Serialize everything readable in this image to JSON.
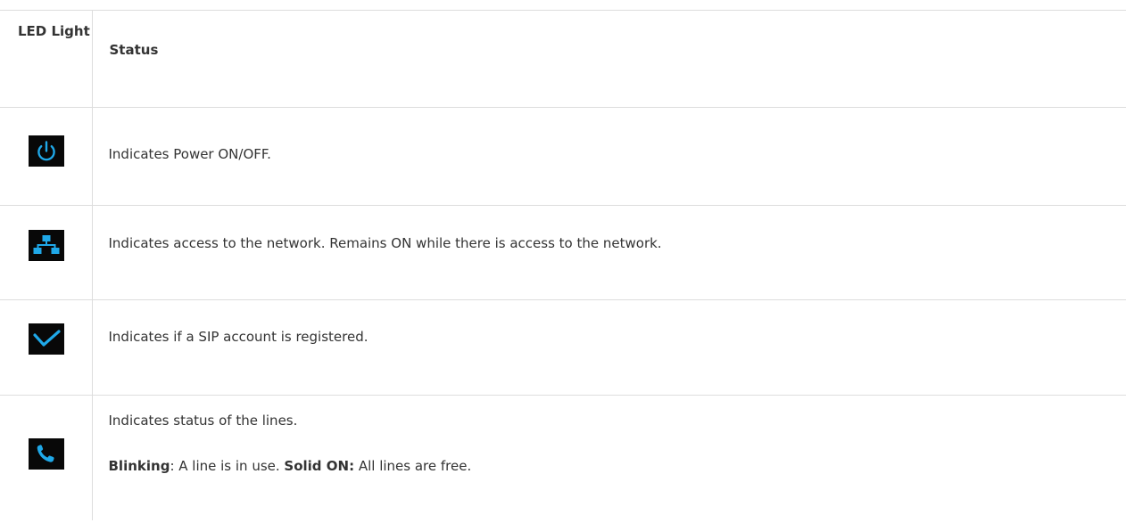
{
  "table": {
    "headers": {
      "led": "LED Light",
      "status": "Status"
    },
    "rows": [
      {
        "icon": "power-icon",
        "status_text": "Indicates Power ON/OFF."
      },
      {
        "icon": "network-icon",
        "status_text": "Indicates access to the network. Remains ON while there is access to the network."
      },
      {
        "icon": "checkmark-icon",
        "status_text": "Indicates if a SIP account is registered."
      },
      {
        "icon": "phone-icon",
        "status_text": "Indicates status of the lines.",
        "detail": {
          "blinking_label": "Blinking",
          "blinking_text": ": A line is in use. ",
          "solid_label": "Solid ON:",
          "solid_text": " All lines are free."
        }
      }
    ]
  },
  "colors": {
    "icon_background": "#080808",
    "icon_accent": "#1fa8e8",
    "border": "#dddddd",
    "text": "#333333"
  }
}
